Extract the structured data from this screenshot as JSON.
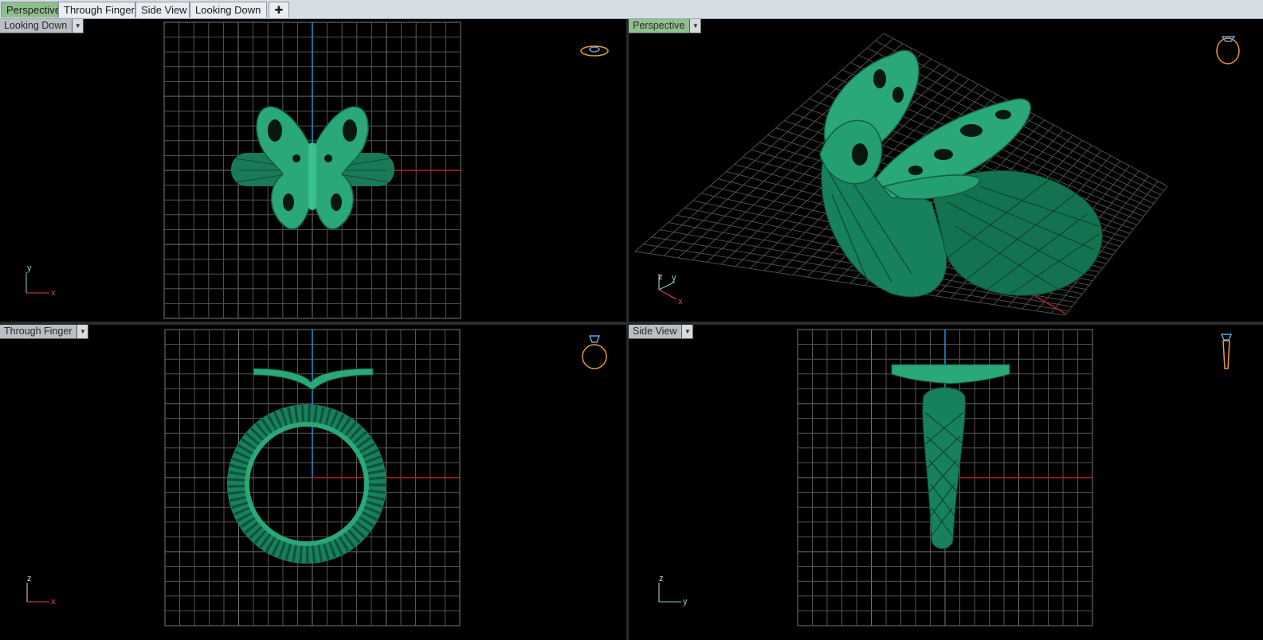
{
  "tabs": [
    {
      "label": "Perspective",
      "active": true
    },
    {
      "label": "Through Finger",
      "active": false
    },
    {
      "label": "Side View",
      "active": false
    },
    {
      "label": "Looking Down",
      "active": false
    }
  ],
  "add_tab_icon": "plus-icon",
  "viewports": {
    "top_left": {
      "label": "Looking Down",
      "axis_h": "x",
      "axis_v": "y"
    },
    "top_right": {
      "label": "Perspective",
      "axis_h": "x",
      "axis_v": "y",
      "axis_z": "z"
    },
    "bottom_left": {
      "label": "Through Finger",
      "axis_h": "x",
      "axis_v": "z"
    },
    "bottom_right": {
      "label": "Side View",
      "axis_h": "y",
      "axis_v": "z"
    }
  },
  "colors": {
    "model": "#1f8f66",
    "grid": "#5a5a5a",
    "x_axis": "#c02020",
    "y_axis": "#2a8fd0",
    "active_tab": "#8fbf8f"
  }
}
